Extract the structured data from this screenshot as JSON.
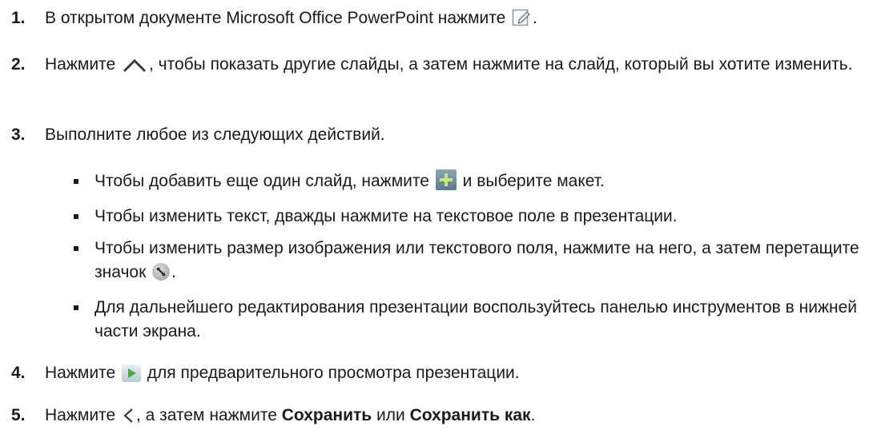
{
  "steps": [
    {
      "number": "1.",
      "before": "В открытом документе Microsoft Office PowerPoint нажмите ",
      "after": ".",
      "icon": "edit-icon"
    },
    {
      "number": "2.",
      "before": "Нажмите ",
      "after": ", чтобы показать другие слайды, а затем нажмите на слайд, который вы хотите изменить.",
      "icon": "chevron-up-icon"
    },
    {
      "number": "3.",
      "text": "Выполните любое из следующих действий."
    },
    {
      "number": "4.",
      "before": "Нажмите ",
      "after": " для предварительного просмотра презентации.",
      "icon": "play-icon"
    },
    {
      "number": "5.",
      "before": "Нажмите ",
      "middle": ", а затем нажмите ",
      "bold1": "Сохранить",
      "or": " или ",
      "bold2": "Сохранить как",
      "end": ".",
      "icon": "chevron-left-icon"
    }
  ],
  "bullets": [
    {
      "before": "Чтобы добавить еще один слайд, нажмите ",
      "after": " и выберите макет.",
      "icon": "add-slide-icon"
    },
    {
      "text": "Чтобы изменить текст, дважды нажмите на текстовое поле в презентации."
    },
    {
      "before": "Чтобы изменить размер изображения или текстового поля, нажмите на него, а затем перетащите значок ",
      "after": ".",
      "icon": "resize-handle-icon"
    },
    {
      "text": "Для дальнейшего редактирования презентации воспользуйтесь панелью инструментов в нижней части экрана."
    }
  ],
  "colors": {
    "text": "#1a1a1a",
    "plus_accent": "#c9e876"
  }
}
